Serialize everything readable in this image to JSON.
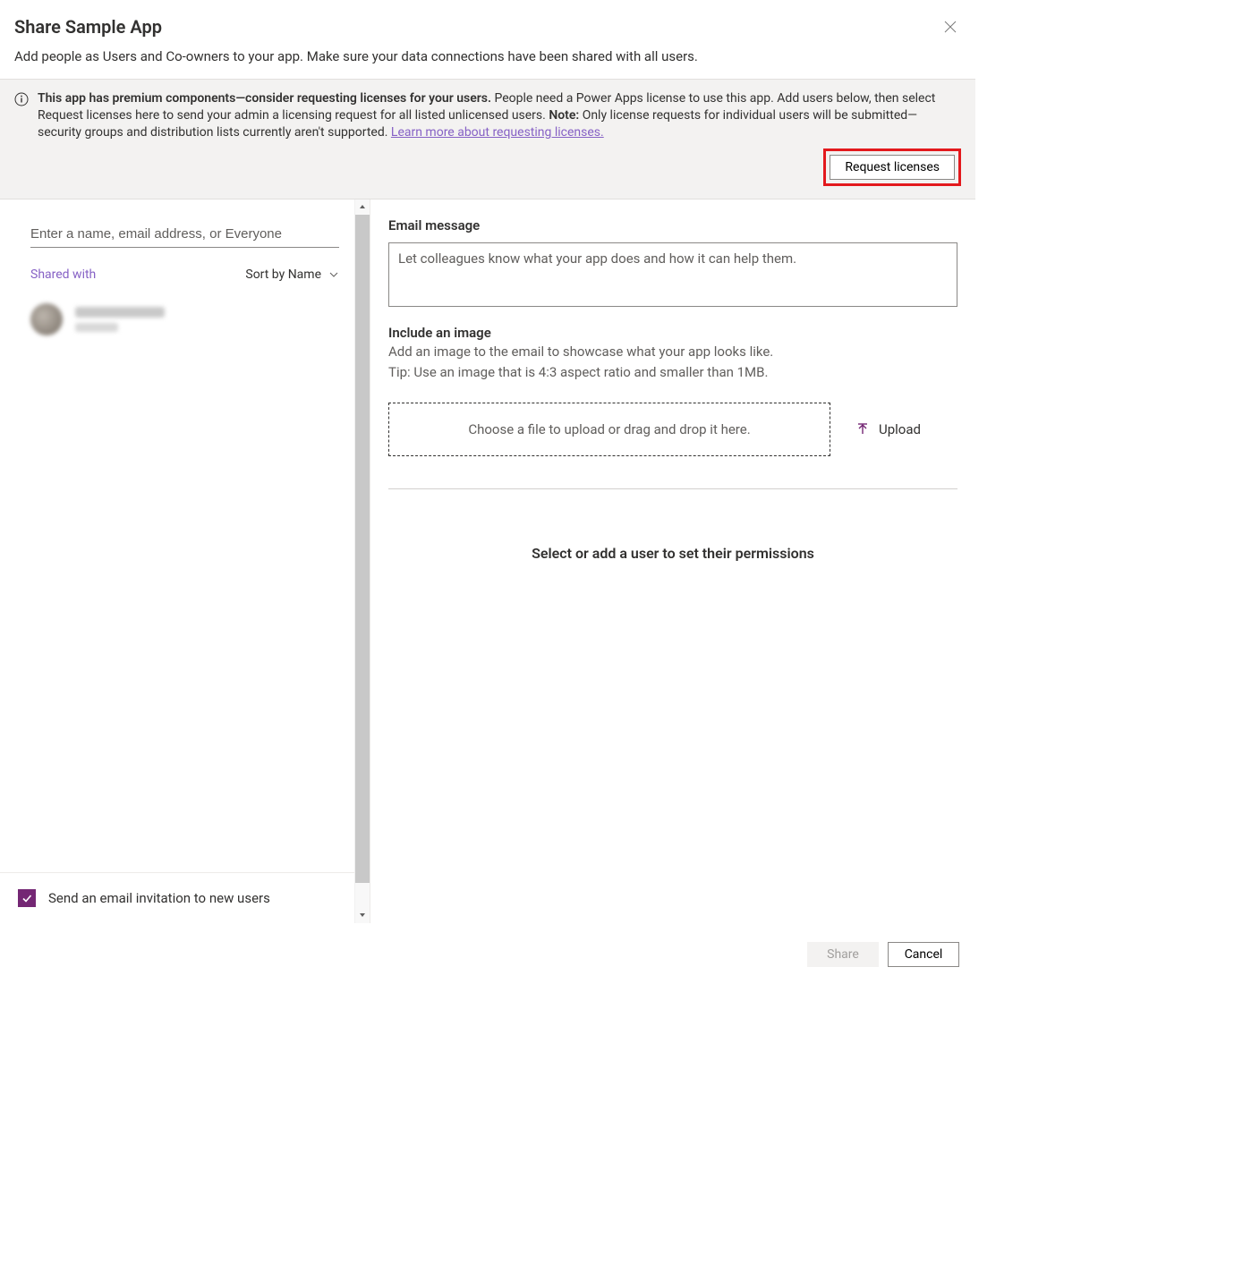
{
  "title": "Share Sample App",
  "subtitle": "Add people as Users and Co-owners to your app. Make sure your data connections have been shared with all users.",
  "banner": {
    "bold_lead": "This app has premium components—consider requesting licenses for your users.",
    "body_1": " People need a Power Apps license to use this app. Add users below, then select Request licenses here to send your admin a licensing request for all listed unlicensed users. ",
    "note_label": "Note:",
    "body_2": " Only license requests for individual users will be submitted—security groups and distribution lists currently aren't supported. ",
    "learn_more": "Learn more about requesting licenses.",
    "request_btn": "Request licenses"
  },
  "left": {
    "input_placeholder": "Enter a name, email address, or Everyone",
    "shared_with": "Shared with",
    "sort_by": "Sort by Name"
  },
  "right": {
    "email_label": "Email message",
    "email_placeholder": "Let colleagues know what your app does and how it can help them.",
    "include_label": "Include an image",
    "include_sub1": "Add an image to the email to showcase what your app looks like.",
    "include_sub2": "Tip: Use an image that is 4:3 aspect ratio and smaller than 1MB.",
    "dropzone": "Choose a file to upload or drag and drop it here.",
    "upload_btn": "Upload",
    "perm_placeholder": "Select or add a user to set their permissions"
  },
  "footer": {
    "send_invite": "Send an email invitation to new users",
    "share_btn": "Share",
    "cancel_btn": "Cancel"
  }
}
